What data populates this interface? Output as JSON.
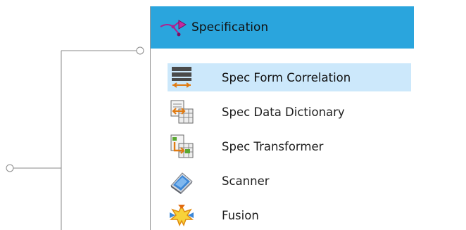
{
  "panel": {
    "title": "Specification",
    "header_icon": "branch-arrow-icon",
    "header_color": "#2aa5dd",
    "selected_color": "#cce8fb"
  },
  "menu": {
    "items": [
      {
        "label": "Spec Form Correlation",
        "icon": "form-correlation-icon",
        "selected": true
      },
      {
        "label": "Spec Data Dictionary",
        "icon": "data-dictionary-icon",
        "selected": false
      },
      {
        "label": "Spec Transformer",
        "icon": "transformer-icon",
        "selected": false
      },
      {
        "label": "Scanner",
        "icon": "scanner-icon",
        "selected": false
      },
      {
        "label": "Fusion",
        "icon": "fusion-icon",
        "selected": false
      }
    ]
  }
}
